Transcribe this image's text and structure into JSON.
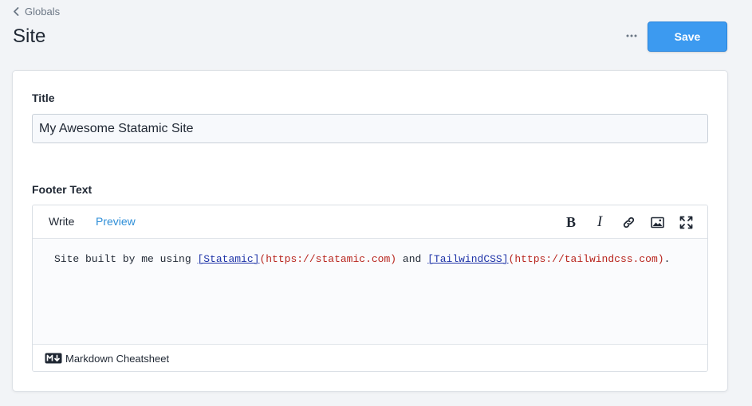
{
  "breadcrumb": {
    "label": "Globals"
  },
  "page": {
    "title": "Site"
  },
  "actions": {
    "save_label": "Save"
  },
  "fields": {
    "title": {
      "label": "Title",
      "value": "My Awesome Statamic Site"
    },
    "footer": {
      "label": "Footer Text",
      "tabs": {
        "write": "Write",
        "preview": "Preview"
      },
      "toolbar": {
        "bold": "B",
        "italic": "I"
      },
      "content": {
        "prefix": "Site built by me using ",
        "link1_text": "[Statamic]",
        "link1_url": "(https://statamic.com)",
        "middle": " and ",
        "link2_text": "[TailwindCSS]",
        "link2_url": "(https://tailwindcss.com)",
        "suffix": "."
      },
      "cheatsheet_label": "Markdown Cheatsheet"
    }
  },
  "colors": {
    "accent": "#3c9af0",
    "preview_tab": "#2f8fd8",
    "link_text": "#1f34a8",
    "link_url": "#b8251e"
  }
}
